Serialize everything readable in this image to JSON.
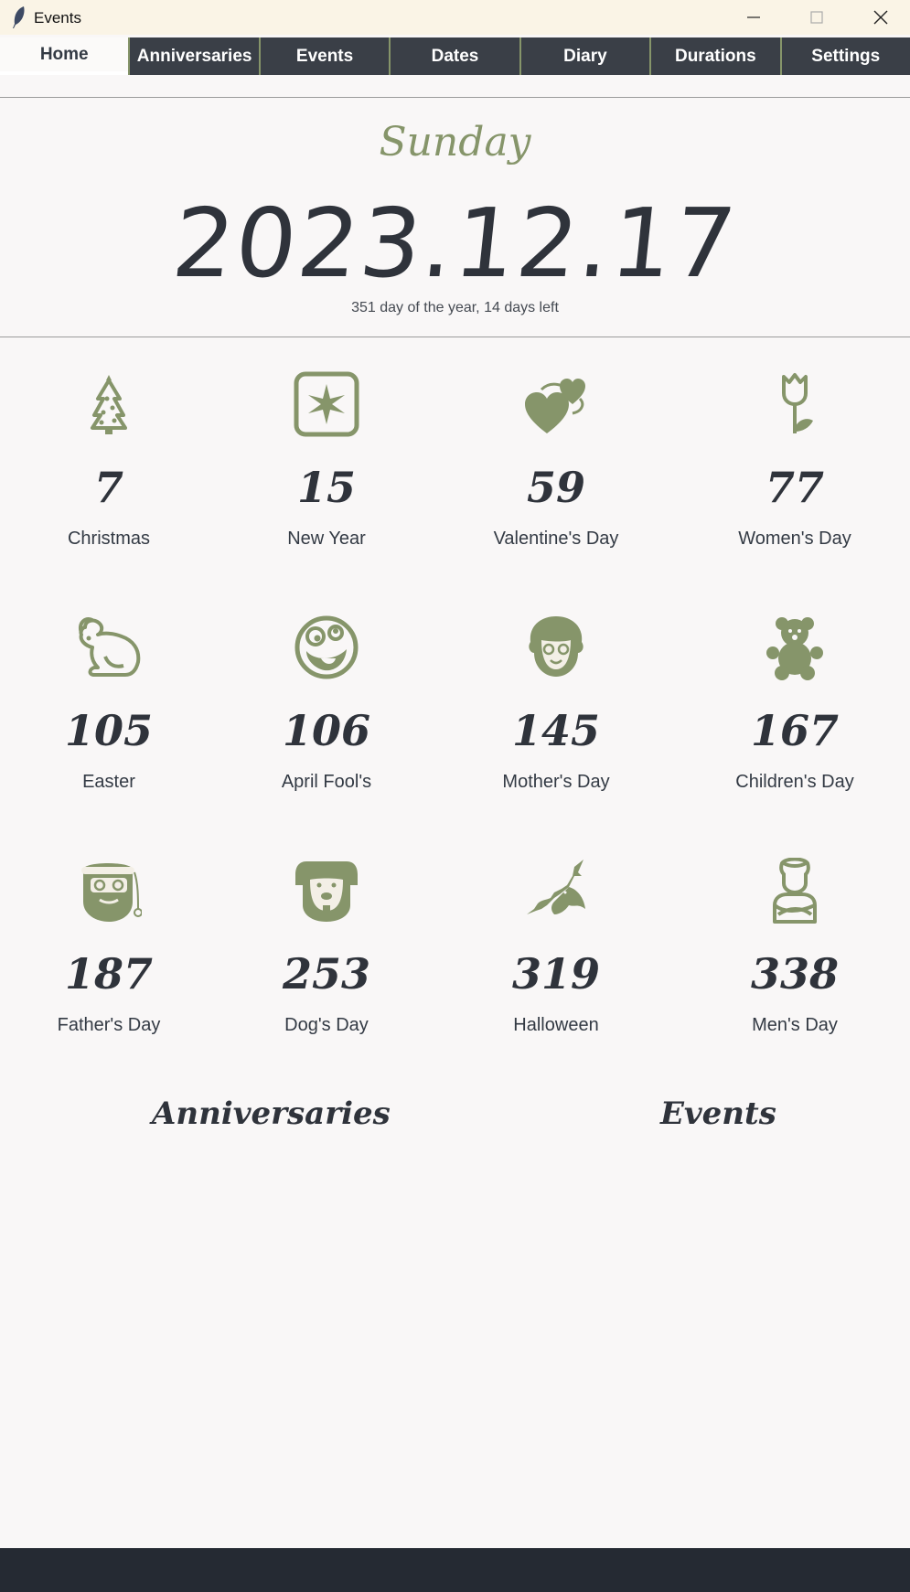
{
  "window": {
    "title": "Events"
  },
  "tabs": [
    "Home",
    "Anniversaries",
    "Events",
    "Dates",
    "Diary",
    "Durations",
    "Settings"
  ],
  "today": {
    "weekday": "Sunday",
    "date": "2023.12.17",
    "summary": "351 day of the year, 14 days left"
  },
  "holidays": [
    {
      "days": "7",
      "name": "Christmas",
      "icon": "christmas-tree-icon"
    },
    {
      "days": "15",
      "name": "New Year",
      "icon": "fireworks-icon"
    },
    {
      "days": "59",
      "name": "Valentine's Day",
      "icon": "hearts-icon"
    },
    {
      "days": "77",
      "name": "Women's Day",
      "icon": "rose-icon"
    },
    {
      "days": "105",
      "name": "Easter",
      "icon": "rabbit-icon"
    },
    {
      "days": "106",
      "name": "April Fool's",
      "icon": "zany-face-icon"
    },
    {
      "days": "145",
      "name": "Mother's Day",
      "icon": "grandmother-icon"
    },
    {
      "days": "167",
      "name": "Children's Day",
      "icon": "teddy-bear-icon"
    },
    {
      "days": "187",
      "name": "Father's Day",
      "icon": "santa-father-icon"
    },
    {
      "days": "253",
      "name": "Dog's Day",
      "icon": "dog-face-icon"
    },
    {
      "days": "319",
      "name": "Halloween",
      "icon": "bat-icon"
    },
    {
      "days": "338",
      "name": "Men's Day",
      "icon": "man-crossed-arms-icon"
    }
  ],
  "sections": {
    "anniversaries": "Anniversaries",
    "events": "Events"
  },
  "colors": {
    "accent": "#86956a",
    "tab_bg": "#3a3f47",
    "text": "#2f333b",
    "status_bar": "#252a33"
  }
}
